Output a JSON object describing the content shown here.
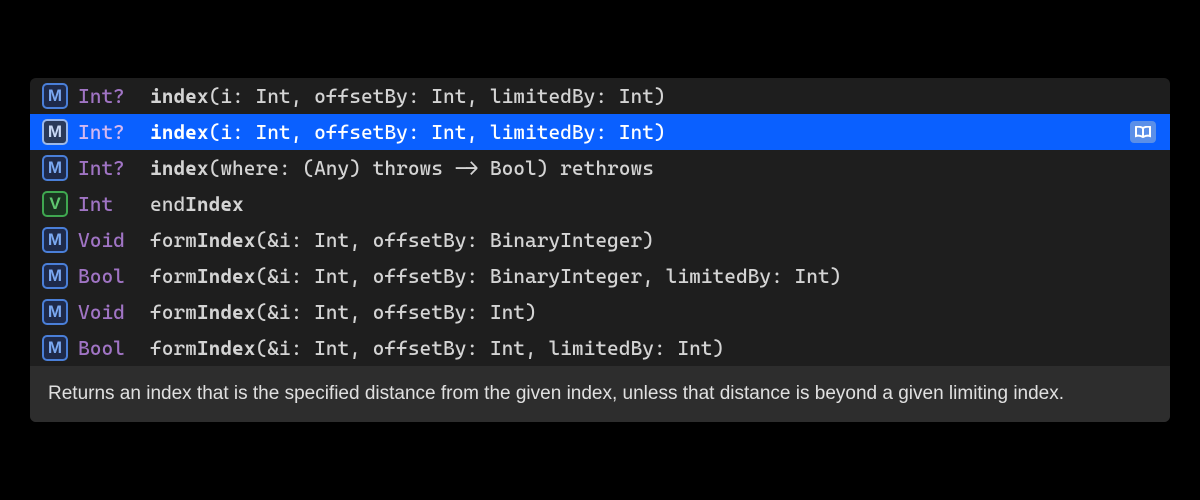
{
  "completions": [
    {
      "kind": "M",
      "badgeClass": "badge-m",
      "returnType": "Int?",
      "name": "index",
      "boldPart": "index",
      "rest": "(i: Int, offsetBy: Int, limitedBy: Int)",
      "selected": false
    },
    {
      "kind": "M",
      "badgeClass": "badge-m",
      "returnType": "Int?",
      "name": "index",
      "boldPart": "index",
      "rest": "(i: Int, offsetBy: Int, limitedBy: Int)",
      "selected": true,
      "hasDoc": true
    },
    {
      "kind": "M",
      "badgeClass": "badge-m",
      "returnType": "Int?",
      "name": "index",
      "boldPart": "index",
      "rest": "(where: (Any) throws -> Bool) rethrows",
      "selected": false
    },
    {
      "kind": "V",
      "badgeClass": "badge-v",
      "returnType": "Int ",
      "name": "endIndex",
      "pre": "end",
      "boldPart": "Index",
      "rest": "",
      "selected": false
    },
    {
      "kind": "M",
      "badgeClass": "badge-m",
      "returnType": "Void",
      "name": "formIndex",
      "pre": "form",
      "boldPart": "Index",
      "rest": "(&i: Int, offsetBy: BinaryInteger)",
      "selected": false
    },
    {
      "kind": "M",
      "badgeClass": "badge-m",
      "returnType": "Bool",
      "name": "formIndex",
      "pre": "form",
      "boldPart": "Index",
      "rest": "(&i: Int, offsetBy: BinaryInteger, limitedBy: Int)",
      "selected": false
    },
    {
      "kind": "M",
      "badgeClass": "badge-m",
      "returnType": "Void",
      "name": "formIndex",
      "pre": "form",
      "boldPart": "Index",
      "rest": "(&i: Int, offsetBy: Int)",
      "selected": false
    },
    {
      "kind": "M",
      "badgeClass": "badge-m",
      "returnType": "Bool",
      "name": "formIndex",
      "pre": "form",
      "boldPart": "Index",
      "rest": "(&i: Int, offsetBy: Int, limitedBy: Int)",
      "selected": false
    }
  ],
  "summary": "Returns an index that is the specified distance from the given index, unless that distance is beyond a given limiting index."
}
